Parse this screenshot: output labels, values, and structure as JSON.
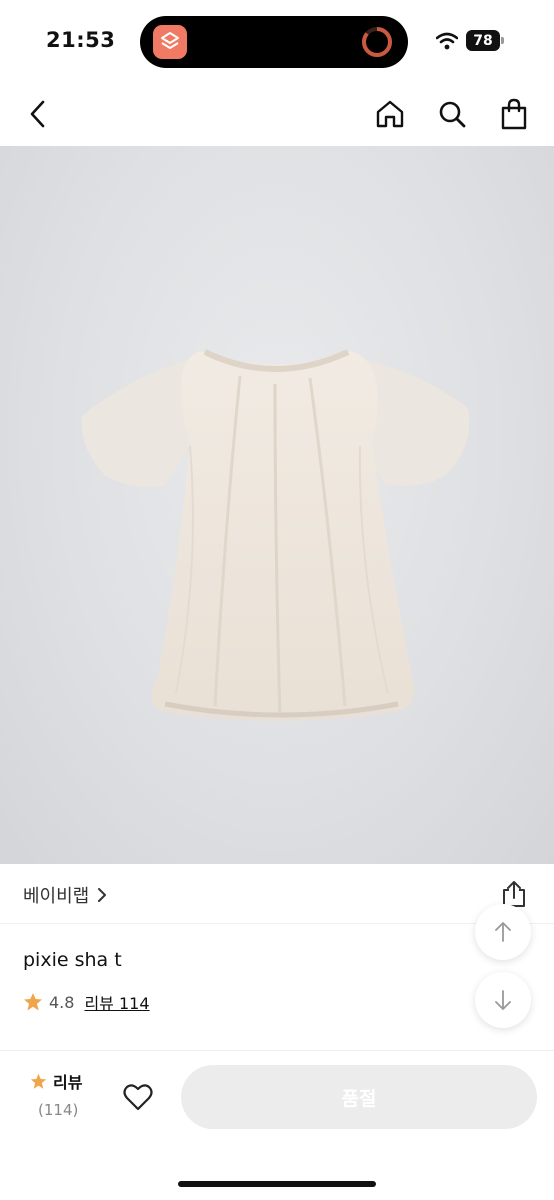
{
  "status_bar": {
    "time": "21:53",
    "battery": "78",
    "icons": [
      "shortcuts-app-icon",
      "activity-ring-icon",
      "wifi-icon",
      "battery-icon"
    ]
  },
  "nav": {
    "icons": [
      "back-chevron-icon",
      "home-icon",
      "search-icon",
      "shopping-bag-icon"
    ]
  },
  "product": {
    "brand": "베이비랩",
    "name": "pixie sha t",
    "rating": "4.8",
    "review_link": "리뷰 114",
    "image_description_colors": {
      "background": "#dfe0e3",
      "garment": "#efe7dd"
    }
  },
  "bottom_bar": {
    "review_label": "리뷰",
    "review_count": "(114)",
    "buy_label": "품절"
  },
  "colors": {
    "star": "#f0a54a",
    "disabled_button": "#ececec",
    "island_app": "#f07a63"
  }
}
